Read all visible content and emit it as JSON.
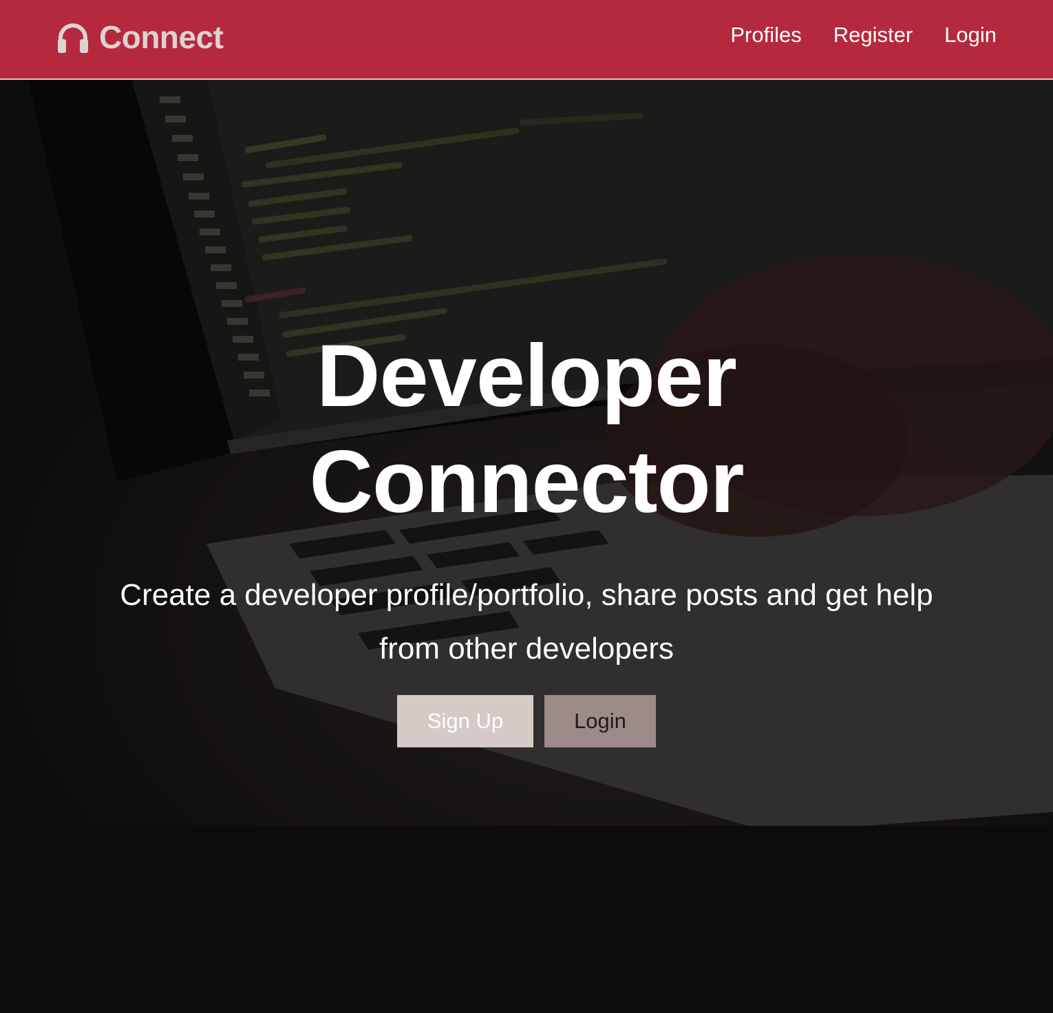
{
  "navbar": {
    "brand_text": "Connect",
    "brand_icon": "headphones-icon",
    "links": [
      {
        "label": "Profiles"
      },
      {
        "label": "Register"
      },
      {
        "label": "Login"
      }
    ]
  },
  "hero": {
    "title": "Developer Connector",
    "subtitle": "Create a developer profile/portfolio, share posts and get help from other developers",
    "signup_label": "Sign Up",
    "login_label": "Login"
  },
  "colors": {
    "navbar_bg": "#b5293e",
    "brand": "#ddd3cf",
    "signup_bg": "#d4cbc6",
    "login_bg": "#9c8b88"
  }
}
